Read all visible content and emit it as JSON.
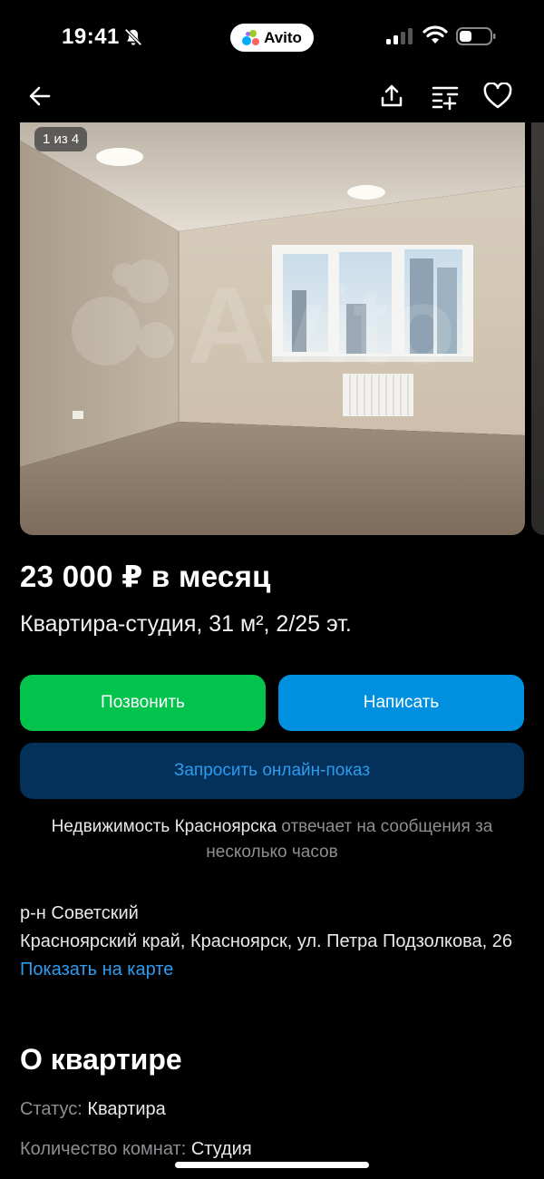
{
  "status_bar": {
    "time": "19:41",
    "app_badge": "Avito",
    "icons": [
      "bell-slash-icon",
      "cellular-signal-icon",
      "wifi-icon",
      "battery-icon"
    ]
  },
  "nav": {
    "icons": [
      "back-arrow-icon",
      "share-icon",
      "compare-list-icon",
      "heart-icon"
    ]
  },
  "gallery": {
    "counter": "1 из 4"
  },
  "listing": {
    "price": "23 000 ₽ в месяц",
    "subtitle": "Квартира-студия, 31 м², 2/25 эт."
  },
  "actions": {
    "call": "Позвонить",
    "write": "Написать",
    "online_show": "Запросить онлайн-показ"
  },
  "seller_reply": {
    "seller": "Недвижимость Красноярска",
    "text": " отвечает на сообщения за несколько часов"
  },
  "address": {
    "district": "р-н Советский",
    "street": "Красноярский край, Красноярск, ул. Петра Подзолкова, 26",
    "map_link": "Показать на карте"
  },
  "about": {
    "title": "О квартире",
    "params": [
      {
        "key": "Статус: ",
        "value": "Квартира"
      },
      {
        "key": "Количество комнат: ",
        "value": "Студия"
      }
    ]
  },
  "colors": {
    "background": "#000000",
    "call_green": "#02c44d",
    "write_blue": "#0190e0",
    "show_navy": "#04315a",
    "link_blue": "#2d9cf0",
    "muted_gray": "#8e8e93"
  }
}
